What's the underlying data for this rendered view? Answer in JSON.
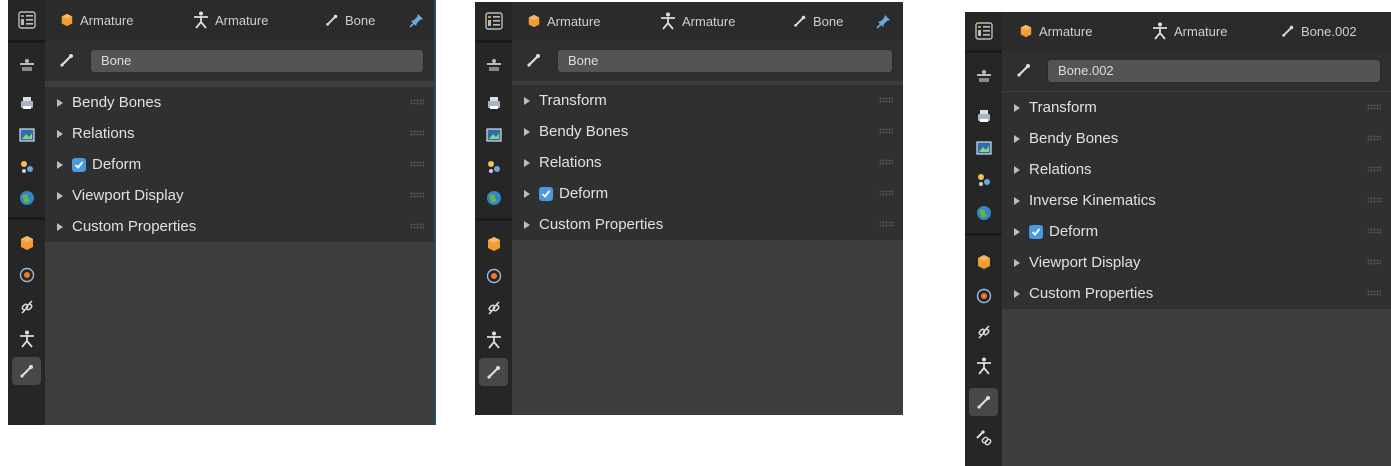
{
  "colors": {
    "tab_bg": "#262626",
    "header_bg": "#2b2b2b",
    "panel_bg": "#303030",
    "checkbox": "#4a9ae2",
    "pin_active": "#6fa8dc"
  },
  "panels": [
    {
      "header": {
        "object": "Armature",
        "data": "Armature",
        "bone": "Bone",
        "pin": "pin-icon"
      },
      "name_value": "Bone",
      "sections": [
        {
          "label": "Bendy Bones"
        },
        {
          "label": "Relations"
        },
        {
          "label": "Deform",
          "checked": true
        },
        {
          "label": "Viewport Display"
        },
        {
          "label": "Custom Properties"
        }
      ]
    },
    {
      "header": {
        "object": "Armature",
        "data": "Armature",
        "bone": "Bone",
        "pin": "pin-icon"
      },
      "name_value": "Bone",
      "sections": [
        {
          "label": "Transform"
        },
        {
          "label": "Bendy Bones"
        },
        {
          "label": "Relations"
        },
        {
          "label": "Deform",
          "checked": true
        },
        {
          "label": "Custom Properties"
        }
      ]
    },
    {
      "header": {
        "object": "Armature",
        "data": "Armature",
        "bone": "Bone.002"
      },
      "name_value": "Bone.002",
      "sections": [
        {
          "label": "Transform"
        },
        {
          "label": "Bendy Bones"
        },
        {
          "label": "Relations"
        },
        {
          "label": "Inverse Kinematics"
        },
        {
          "label": "Deform",
          "checked": true
        },
        {
          "label": "Viewport Display"
        },
        {
          "label": "Custom Properties"
        }
      ]
    }
  ]
}
